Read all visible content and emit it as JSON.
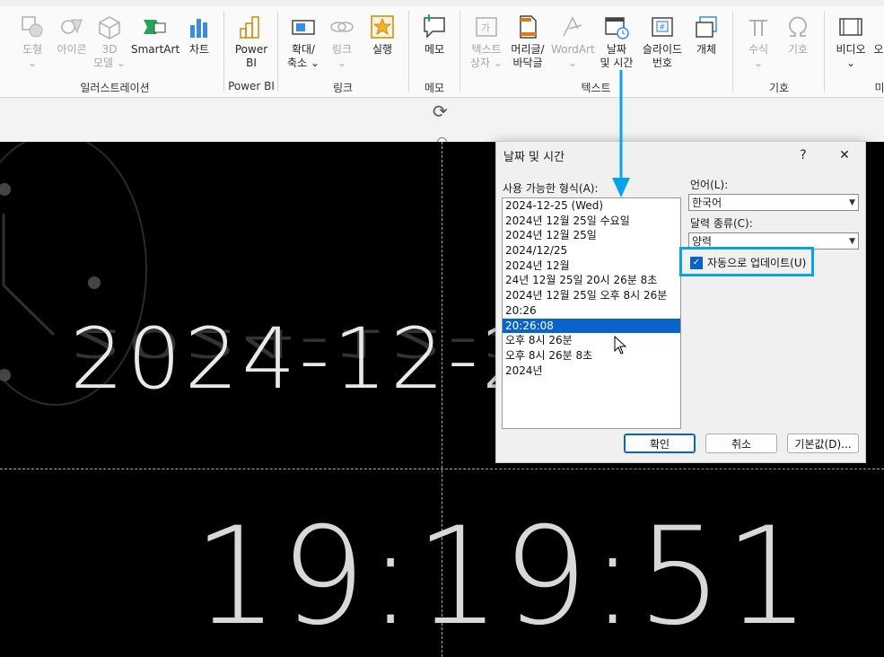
{
  "ribbon": {
    "buttons": [
      {
        "id": "shapes",
        "label": "도형",
        "sub": "⌄",
        "disabled": true
      },
      {
        "id": "icons",
        "label": "아이콘",
        "disabled": true
      },
      {
        "id": "3d",
        "label": "3D",
        "sub": "모델 ⌄",
        "disabled": true
      },
      {
        "id": "smartart",
        "label": "SmartArt",
        "disabled": false
      },
      {
        "id": "chart",
        "label": "차트",
        "disabled": false
      },
      {
        "id": "powerbi",
        "label": "Power",
        "sub": "BI",
        "disabled": false
      },
      {
        "id": "zoom",
        "label": "확대/",
        "sub": "축소 ⌄",
        "disabled": false
      },
      {
        "id": "link",
        "label": "링크",
        "sub": "⌄",
        "disabled": true
      },
      {
        "id": "action",
        "label": "실행",
        "disabled": false
      },
      {
        "id": "memo",
        "label": "메모",
        "disabled": false
      },
      {
        "id": "textbox",
        "label": "텍스트",
        "sub": "상자 ⌄",
        "disabled": true
      },
      {
        "id": "headerfooter",
        "label": "머리글/",
        "sub": "바닥글",
        "disabled": false
      },
      {
        "id": "wordart",
        "label": "WordArt",
        "sub": "⌄",
        "disabled": true
      },
      {
        "id": "datetime",
        "label": "날짜",
        "sub": "및 시간",
        "disabled": false
      },
      {
        "id": "slidenum",
        "label": "슬라이드",
        "sub": "번호",
        "disabled": false
      },
      {
        "id": "object",
        "label": "개체",
        "disabled": false
      },
      {
        "id": "equation",
        "label": "수식",
        "sub": "⌄",
        "disabled": true
      },
      {
        "id": "symbol",
        "label": "기호",
        "disabled": true
      },
      {
        "id": "video",
        "label": "비디오",
        "sub": "⌄",
        "disabled": false
      },
      {
        "id": "audio",
        "label": "오",
        "disabled": false
      }
    ],
    "groups": {
      "illustrations": "일러스트레이션",
      "powerbi": "Power BI",
      "links": "링크",
      "memo": "메모",
      "text": "텍스트",
      "symbols": "기호",
      "media": "미"
    }
  },
  "slide": {
    "date_text": "2024-12-2",
    "time_text": "19:19:51"
  },
  "dialog": {
    "title": "날짜 및 시간",
    "help": "?",
    "close": "✕",
    "formats_label": "사용 가능한 형식(A):",
    "formats": [
      "2024-12-25 (Wed)",
      "2024년 12월 25일 수요일",
      "2024년 12월 25일",
      "2024/12/25",
      "2024년 12월",
      "24년 12월 25일 20시 26분 8초",
      "2024년 12월 25일 오후 8시 26분",
      "20:26",
      "20:26:08",
      "오후 8시 26분",
      "오후 8시 26분 8초",
      "2024년"
    ],
    "selected_index": 8,
    "language_label": "언어(L):",
    "language_value": "한국어",
    "calendar_label": "달력 종류(C):",
    "calendar_value": "양력",
    "auto_update_label": "자동으로 업데이트(U)",
    "auto_update_checked": true,
    "ok": "확인",
    "cancel": "취소",
    "default": "기본값(D)..."
  },
  "colors": {
    "highlight": "#0aa3e8",
    "selection": "#0a63c9"
  }
}
